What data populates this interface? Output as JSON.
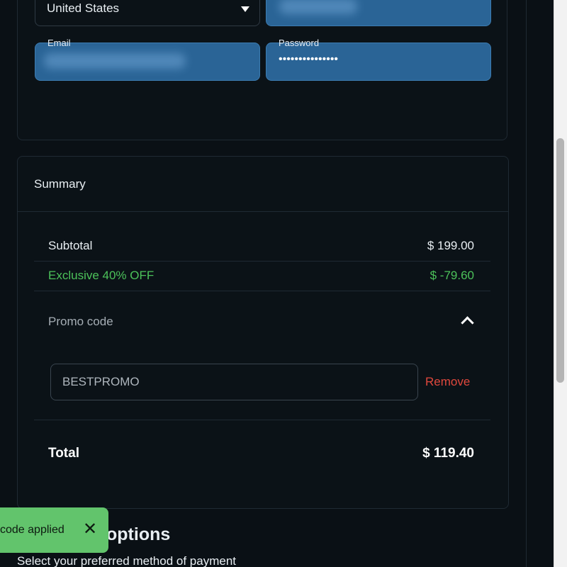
{
  "account": {
    "country": "United States",
    "email_label": "Email",
    "password_label": "Password",
    "password_mask": "•••••••••••••••"
  },
  "summary": {
    "title": "Summary",
    "subtotal_label": "Subtotal",
    "subtotal_value": "$ 199.00",
    "discount_label": "Exclusive 40% OFF",
    "discount_value": "$ -79.60",
    "promo_label": "Promo code",
    "promo_value": "BESTPROMO",
    "remove_label": "Remove",
    "total_label": "Total",
    "total_value": "$ 119.40"
  },
  "payment": {
    "title": "options",
    "subtitle": "Select your preferred method of payment"
  },
  "toast": {
    "message": "code applied",
    "close_glyph": "✕"
  },
  "colors": {
    "background": "#0a1015",
    "field": "#2a6496",
    "discount": "#4cc25a",
    "remove": "#e0483d",
    "toast": "#62c46c"
  },
  "icons": [
    "chevron-down-icon",
    "chevron-up-icon",
    "close-icon"
  ]
}
